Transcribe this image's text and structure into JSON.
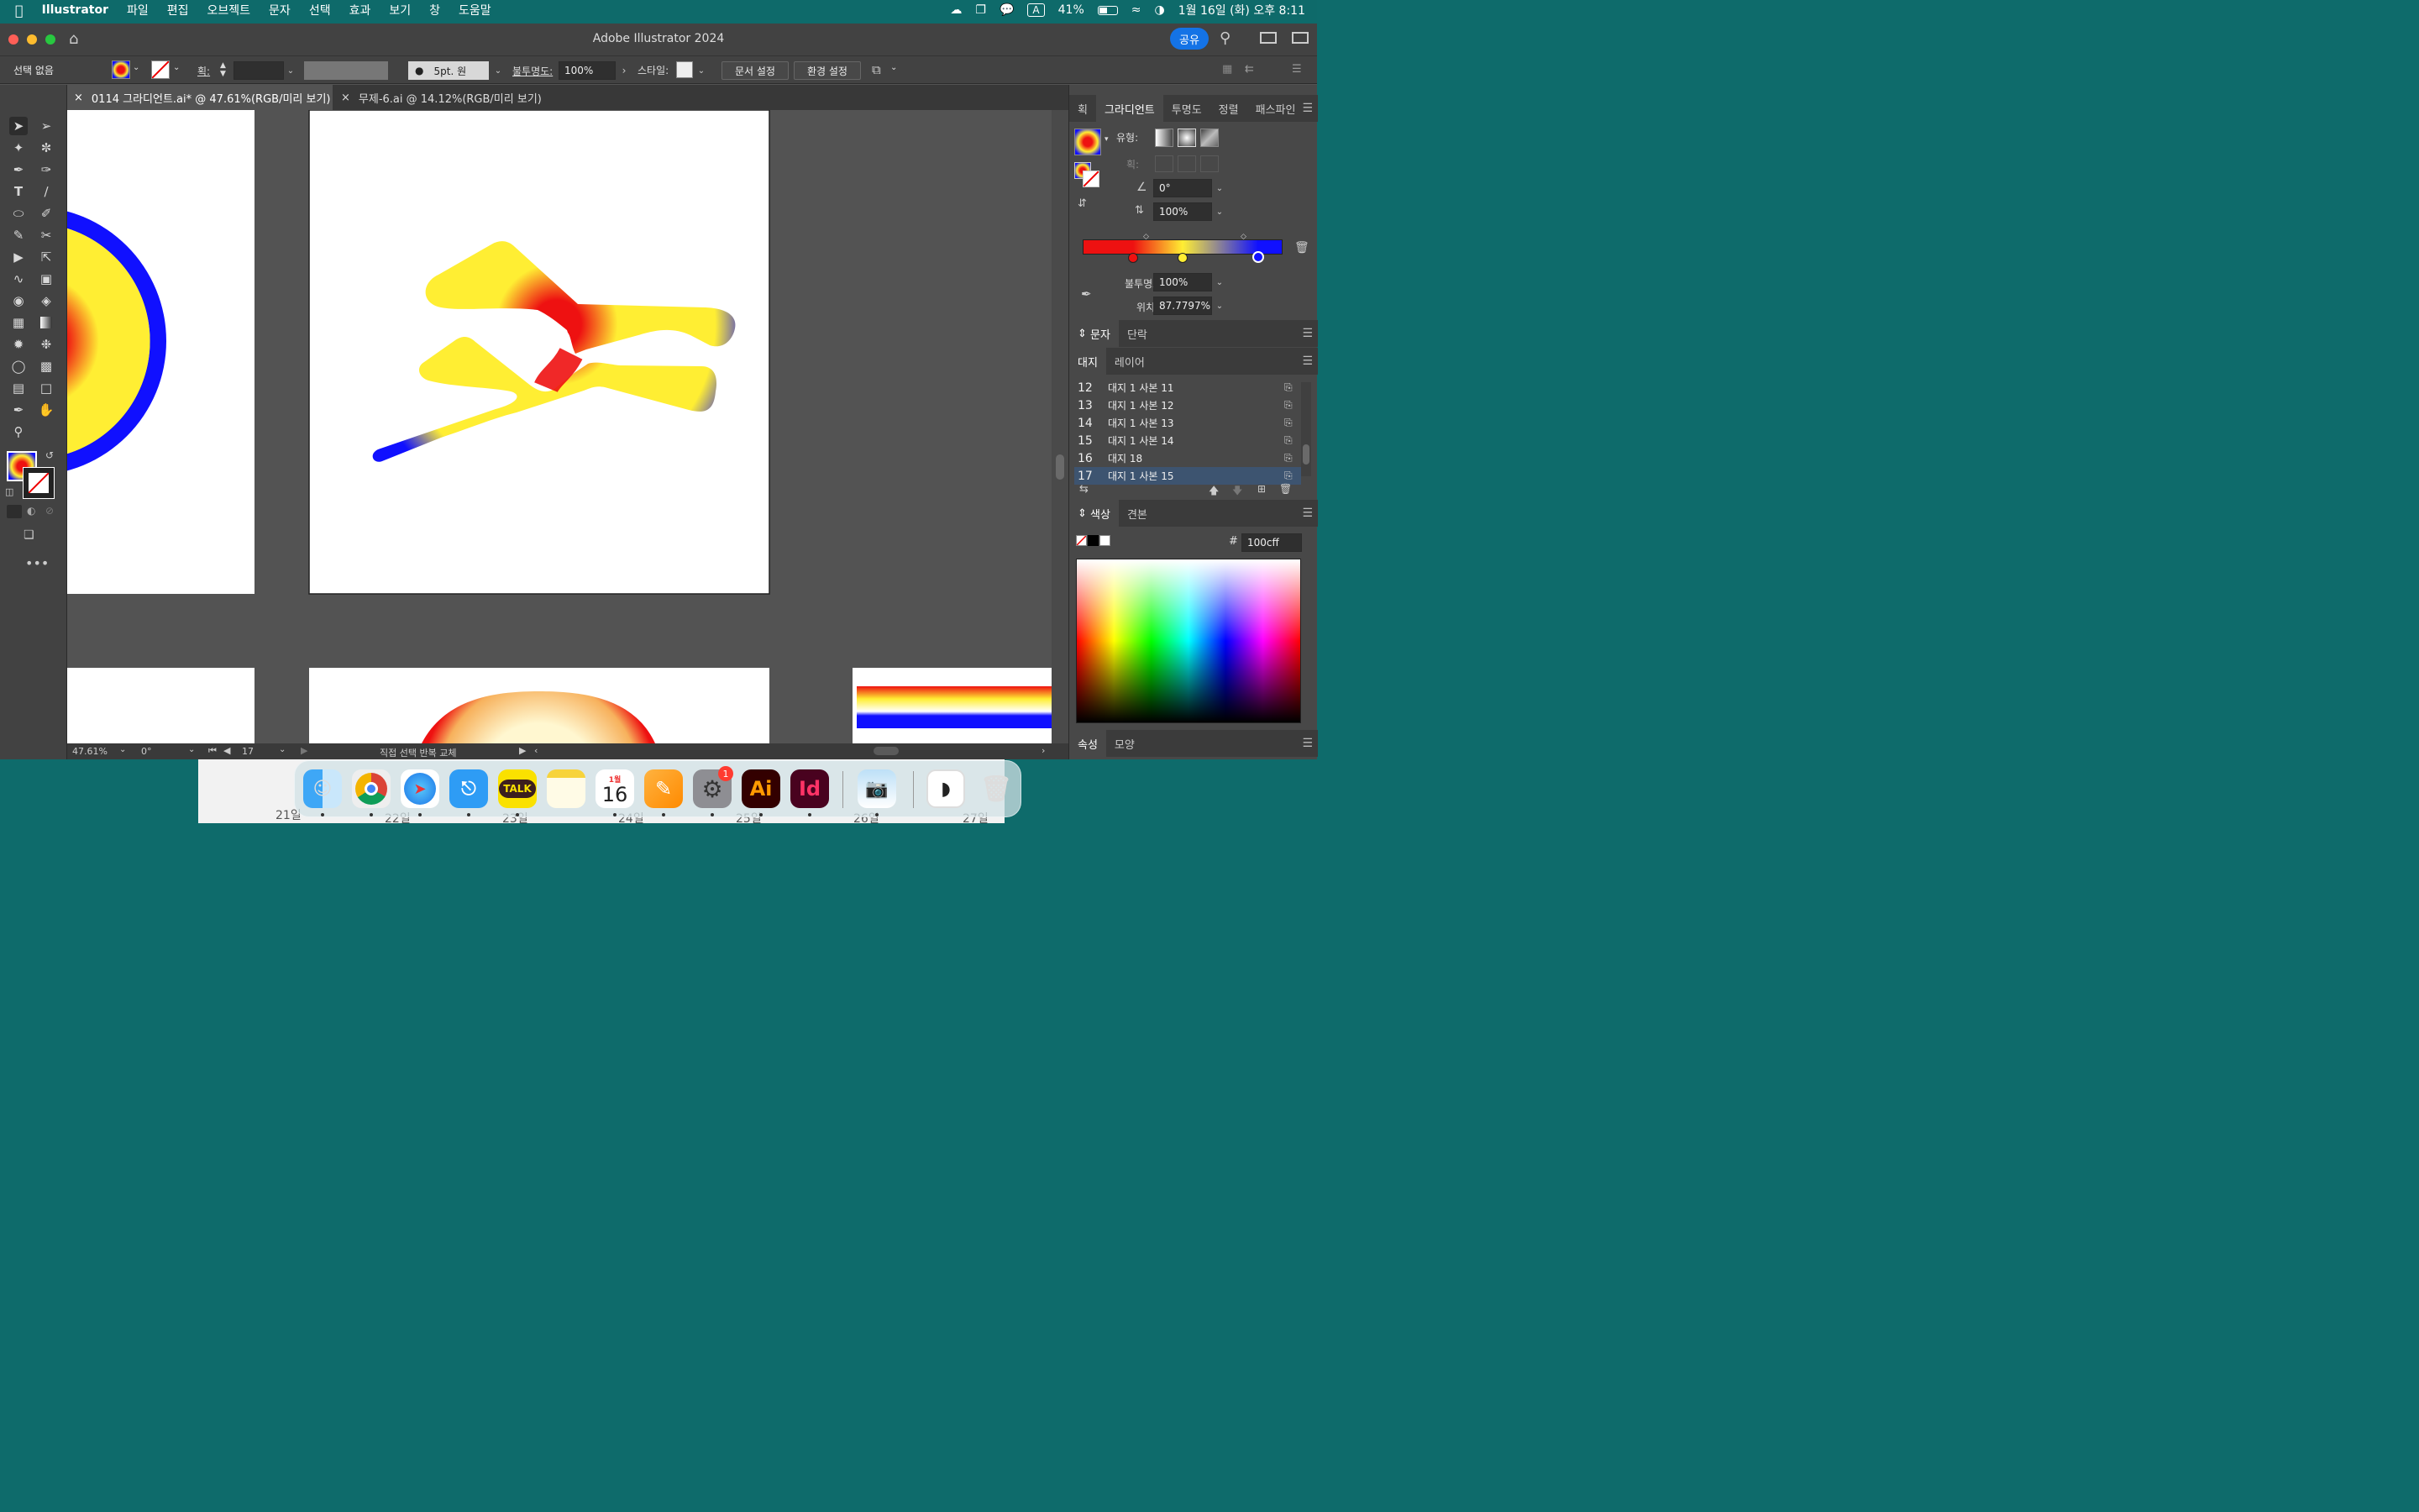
{
  "menubar": {
    "app": "Illustrator",
    "items": [
      "파일",
      "편집",
      "오브젝트",
      "문자",
      "선택",
      "효과",
      "보기",
      "창",
      "도움말"
    ],
    "battery": "41%",
    "input_mode": "A",
    "datetime": "1월 16일 (화) 오후 8:11"
  },
  "titlebar": {
    "title": "Adobe Illustrator 2024",
    "share": "공유"
  },
  "control": {
    "selection": "선택 없음",
    "stroke_label": "획:",
    "brush": "5pt. 원",
    "opacity_label": "불투명도:",
    "opacity": "100%",
    "style_label": "스타일:",
    "doc_setup": "문서 설정",
    "prefs": "환경 설정"
  },
  "tabs": [
    {
      "label": "0114 그라디언트.ai* @ 47.61%(RGB/미리 보기)",
      "active": true
    },
    {
      "label": "무제-6.ai @ 14.12%(RGB/미리 보기)",
      "active": false
    }
  ],
  "status": {
    "zoom": "47.61%",
    "rotation": "0°",
    "artboard": "17",
    "tool_status": "직접 선택 반복 교체"
  },
  "gradient_panel": {
    "tabs": [
      "획",
      "그라디언트",
      "투명도",
      "정렬",
      "패스파인"
    ],
    "type_label": "유형:",
    "stroke_label": "획:",
    "angle": "0°",
    "aspect": "100%",
    "opacity_label": "불투명도:",
    "opacity": "100%",
    "location_label": "위치:",
    "location": "87.7797%",
    "stops": [
      {
        "color": "#ee1111",
        "position": 0.25
      },
      {
        "color": "#ffee33",
        "position": 0.5
      },
      {
        "color": "#1010ff",
        "position": 0.88
      }
    ]
  },
  "type_panel": {
    "tabs": [
      "문자",
      "단락"
    ]
  },
  "artboards_panel": {
    "tabs": [
      "대지",
      "레이어"
    ],
    "rows": [
      {
        "num": "12",
        "name": "대지 1 사본 11"
      },
      {
        "num": "13",
        "name": "대지 1 사본 12"
      },
      {
        "num": "14",
        "name": "대지 1 사본 13"
      },
      {
        "num": "15",
        "name": "대지 1 사본 14"
      },
      {
        "num": "16",
        "name": "대지 18"
      },
      {
        "num": "17",
        "name": "대지 1 사본 15"
      }
    ],
    "selected": "17"
  },
  "color_panel": {
    "tabs": [
      "색상",
      "견본"
    ],
    "hex_label": "#",
    "hex": "100cff"
  },
  "props_panel": {
    "tabs": [
      "속성",
      "모양"
    ]
  },
  "colors": {
    "accent": "#1473e6",
    "gradient_red": "#ee1111",
    "gradient_yellow": "#ffee33",
    "gradient_blue": "#1010ff"
  },
  "dock": {
    "icons": [
      "finder-icon",
      "chrome-icon",
      "safari-icon",
      "keynote-icon",
      "kakaotalk-icon",
      "notes-icon",
      "calendar-icon",
      "pages-icon",
      "system-settings-icon",
      "illustrator-icon",
      "indesign-icon",
      "preview-icon",
      "photo-icon",
      "trash-icon"
    ],
    "kakao_label": "TALK",
    "calendar_month": "1월",
    "calendar_day": "16",
    "settings_badge": "1",
    "ai_label": "Ai",
    "id_label": "Id"
  },
  "calendar_strip": [
    "21일",
    "22일",
    "23일",
    "24일",
    "25일",
    "26일",
    "27일"
  ]
}
